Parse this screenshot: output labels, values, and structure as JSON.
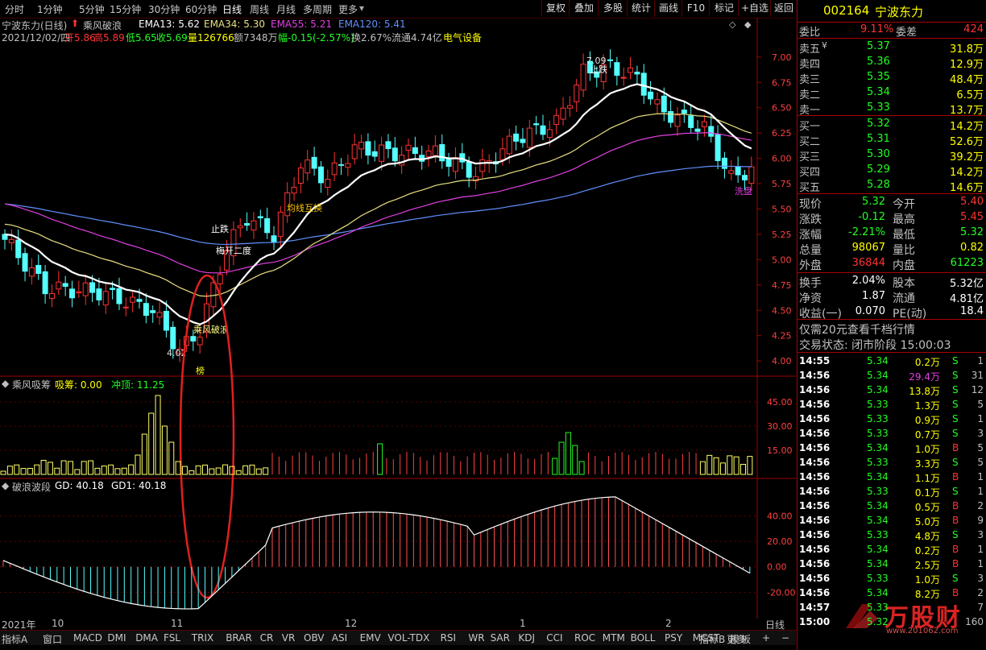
{
  "toolbar": {
    "periods": [
      "分时",
      "1分钟",
      "5分钟",
      "15分钟",
      "30分钟",
      "60分钟",
      "日线",
      "周线",
      "月线",
      "多周期",
      "更多"
    ],
    "active": "日线",
    "buttons": [
      "复权",
      "叠加",
      "多股",
      "统计",
      "画线",
      "F10",
      "标记",
      "+自选",
      "返回"
    ]
  },
  "main": {
    "title": "宁波东力(日线)",
    "indicator": "乘风破浪",
    "ema13": "EMA13: 5.62",
    "ema34": "EMA34: 5.30",
    "ema55": "EMA55: 5.21",
    "ema120": "EMA120: 5.41",
    "info_date": "2021/12/02/四",
    "info_open": "开5.86",
    "info_high": "高5.89",
    "info_low": "低5.65",
    "info_close": "收5.69",
    "info_vol": "量126766",
    "info_amt": "额7348万",
    "info_chg": "幅-0.15(-2.57%)",
    "info_turn": "换2.67%",
    "info_float": "流通4.74亿",
    "info_sector": "电气设备",
    "y_labels": [
      "7.00",
      "6.75",
      "6.50",
      "6.25",
      "6.00",
      "5.75",
      "5.50",
      "5.25",
      "5.00",
      "4.75",
      "4.50",
      "4.25",
      "4.00"
    ],
    "annot_high": "7.09",
    "annot_low": "4.02",
    "annot_zhe": "止跌",
    "annot_zhe2": "止跌",
    "annot_mei": "梅开二度",
    "annot_jun": "均线互换",
    "annot_cf": "乘风破浪",
    "annot_bang": "榜",
    "annot_xi": "洗盘"
  },
  "sub1": {
    "title": "乘风吸筹",
    "xichou": "吸筹: 0.00",
    "chongding": "冲顶: 11.25",
    "y_labels": [
      "45.00",
      "30.00",
      "15.00"
    ]
  },
  "sub2": {
    "title": "破浪波段",
    "gd": "GD: 40.18",
    "gd1": "GD1: 40.18",
    "y_labels": [
      "40.00",
      "20.00",
      "0.00",
      "-20.00"
    ]
  },
  "xaxis": {
    "labels": [
      "2021年",
      "10",
      "11",
      "12",
      "1",
      "2"
    ],
    "period": "日线"
  },
  "bottom_tabs": [
    "指标A",
    "窗口",
    "MACD",
    "DMI",
    "DMA",
    "FSL",
    "TRIX",
    "BRAR",
    "CR",
    "VR",
    "OBV",
    "ASI",
    "EMV",
    "VOL-TDX",
    "RSI",
    "WR",
    "SAR",
    "KDJ",
    "CCI",
    "ROC",
    "MTM",
    "BOLL",
    "PSY",
    "MCST",
    "更多"
  ],
  "bottom_right": [
    "指标B",
    "模",
    "板",
    "+",
    "−"
  ],
  "quote": {
    "code": "002164",
    "name": "宁波东力",
    "weibi_label": "委比",
    "weibi": "9.11%",
    "weicha_label": "委差",
    "weicha": "424",
    "asks": [
      {
        "label": "卖五",
        "price": "5.37",
        "vol": "31.8万"
      },
      {
        "label": "卖四",
        "price": "5.36",
        "vol": "12.9万"
      },
      {
        "label": "卖三",
        "price": "5.35",
        "vol": "48.4万"
      },
      {
        "label": "卖二",
        "price": "5.34",
        "vol": "6.5万"
      },
      {
        "label": "卖一",
        "price": "5.33",
        "vol": "13.7万"
      }
    ],
    "bids": [
      {
        "label": "买一",
        "price": "5.32",
        "vol": "14.2万"
      },
      {
        "label": "买二",
        "price": "5.31",
        "vol": "52.6万"
      },
      {
        "label": "买三",
        "price": "5.30",
        "vol": "39.2万"
      },
      {
        "label": "买四",
        "price": "5.29",
        "vol": "14.2万"
      },
      {
        "label": "买五",
        "price": "5.28",
        "vol": "14.6万"
      }
    ],
    "stats": [
      {
        "l1": "现价",
        "v1": "5.32",
        "l2": "今开",
        "v2": "5.40",
        "c1": "green",
        "c2": "red"
      },
      {
        "l1": "涨跌",
        "v1": "-0.12",
        "l2": "最高",
        "v2": "5.45",
        "c1": "green",
        "c2": "red"
      },
      {
        "l1": "涨幅",
        "v1": "-2.21%",
        "l2": "最低",
        "v2": "5.32",
        "c1": "green",
        "c2": "green"
      },
      {
        "l1": "总量",
        "v1": "98067",
        "l2": "量比",
        "v2": "0.82",
        "c1": "yellow",
        "c2": "yellow"
      },
      {
        "l1": "外盘",
        "v1": "36844",
        "l2": "内盘",
        "v2": "61223",
        "c1": "red",
        "c2": "green"
      }
    ],
    "stats2": [
      {
        "l1": "换手",
        "v1": "2.04%",
        "l2": "股本",
        "v2": "5.32亿"
      },
      {
        "l1": "净资",
        "v1": "1.87",
        "l2": "流通",
        "v2": "4.81亿"
      },
      {
        "l1": "收益(一)",
        "v1": "0.070",
        "l2": "PE(动)",
        "v2": "18.4"
      }
    ],
    "promo": "仅需20元查看千档行情",
    "status": "交易状态: 闭市阶段 15:00:03",
    "ticks": [
      {
        "t": "14:55",
        "p": "5.34",
        "v": "0.2万",
        "d": "S",
        "n": "1"
      },
      {
        "t": "14:56",
        "p": "5.34",
        "v": "29.4万",
        "d": "S",
        "n": "31"
      },
      {
        "t": "14:56",
        "p": "5.34",
        "v": "13.8万",
        "d": "S",
        "n": "12"
      },
      {
        "t": "14:56",
        "p": "5.33",
        "v": "1.3万",
        "d": "S",
        "n": "5"
      },
      {
        "t": "14:56",
        "p": "5.33",
        "v": "0.9万",
        "d": "S",
        "n": "1"
      },
      {
        "t": "14:56",
        "p": "5.33",
        "v": "0.7万",
        "d": "S",
        "n": "3"
      },
      {
        "t": "14:56",
        "p": "5.34",
        "v": "1.0万",
        "d": "B",
        "n": "5"
      },
      {
        "t": "14:56",
        "p": "5.33",
        "v": "3.3万",
        "d": "S",
        "n": "5"
      },
      {
        "t": "14:56",
        "p": "5.34",
        "v": "1.1万",
        "d": "B",
        "n": "1"
      },
      {
        "t": "14:56",
        "p": "5.33",
        "v": "0.1万",
        "d": "S",
        "n": "1"
      },
      {
        "t": "14:56",
        "p": "5.34",
        "v": "0.5万",
        "d": "B",
        "n": "2"
      },
      {
        "t": "14:56",
        "p": "5.34",
        "v": "5.0万",
        "d": "B",
        "n": "9"
      },
      {
        "t": "14:56",
        "p": "5.33",
        "v": "4.8万",
        "d": "S",
        "n": "3"
      },
      {
        "t": "14:56",
        "p": "5.34",
        "v": "0.2万",
        "d": "B",
        "n": "1"
      },
      {
        "t": "14:56",
        "p": "5.34",
        "v": "2.5万",
        "d": "B",
        "n": "1"
      },
      {
        "t": "14:56",
        "p": "5.33",
        "v": "1.0万",
        "d": "S",
        "n": "3"
      },
      {
        "t": "14:56",
        "p": "5.34",
        "v": "8.2万",
        "d": "B",
        "n": "2"
      },
      {
        "t": "14:57",
        "p": "5.33",
        "v": "",
        "d": "",
        "n": "7"
      },
      {
        "t": "15:00",
        "p": "5.32",
        "v": "",
        "d": "",
        "n": "160"
      }
    ],
    "watermark": "万股财",
    "watermark_url": "www.201062.com"
  },
  "colors": {
    "up": "#ff3232",
    "down": "#54ffff",
    "ema13": "#ffffff",
    "ema34": "#e8e080",
    "ema55": "#e040e0",
    "ema120": "#6090ff",
    "grid": "#700000"
  }
}
